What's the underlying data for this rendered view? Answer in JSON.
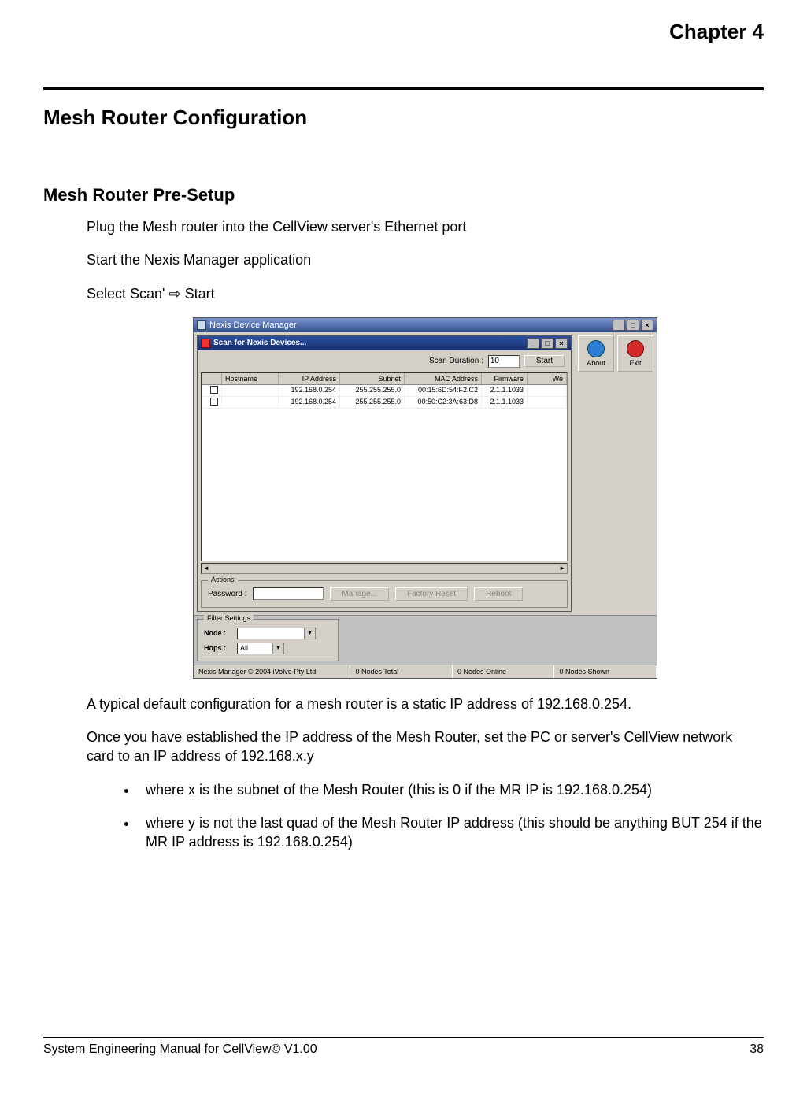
{
  "chapter": "Chapter 4",
  "title": "Mesh Router Configuration",
  "subtitle": "Mesh Router Pre-Setup",
  "p1": "Plug the Mesh router into the CellView server's Ethernet port",
  "p2": "Start the Nexis Manager application",
  "p3": "Select Scan' ⇨ Start",
  "p4": "A typical default configuration for a mesh router is a static IP address of 192.168.0.254.",
  "p5": "Once you have established the IP address of the Mesh Router, set the PC or server's CellView network card to an IP address of 192.168.x.y",
  "b1": "where x is the subnet of the Mesh Router (this is 0 if the MR IP is 192.168.0.254)",
  "b2": "where y is not the last quad of the Mesh Router IP address (this should be anything BUT 254 if the MR IP address is 192.168.0.254)",
  "shot": {
    "outerTitle": "Nexis Device Manager",
    "innerTitle": "Scan for Nexis Devices...",
    "scanLabel": "Scan Duration :",
    "scanVal": "10",
    "startBtn": "Start",
    "aboutBtn": "About",
    "exitBtn": "Exit",
    "cols": {
      "host": "Hostname",
      "ip": "IP Address",
      "sub": "Subnet",
      "mac": "MAC Address",
      "fw": "Firmware",
      "we": "We"
    },
    "rows": [
      {
        "ip": "192.168.0.254",
        "sub": "255.255.255.0",
        "mac": "00:15:6D:54:F2:C2",
        "fw": "2.1.1.1033"
      },
      {
        "ip": "192.168.0.254",
        "sub": "255.255.255.0",
        "mac": "00:50:C2:3A:63:D8",
        "fw": "2.1.1.1033"
      }
    ],
    "actionsLegend": "Actions",
    "pwdLabel": "Password :",
    "manageBtn": "Manage...",
    "factoryBtn": "Factory Reset",
    "rebootBtn": "Reboot",
    "filterLegend": "Filter Settings",
    "nodeLabel": "Node :",
    "hopsLabel": "Hops :",
    "hopsVal": "All",
    "status": {
      "s1": "Nexis Manager © 2004 iVolve Pty Ltd",
      "s2": "0 Nodes Total",
      "s3": "0 Nodes Online",
      "s4": "0 Nodes Shown"
    }
  },
  "footer": {
    "left": "System Engineering Manual for CellView© V1.00",
    "page": "38"
  }
}
